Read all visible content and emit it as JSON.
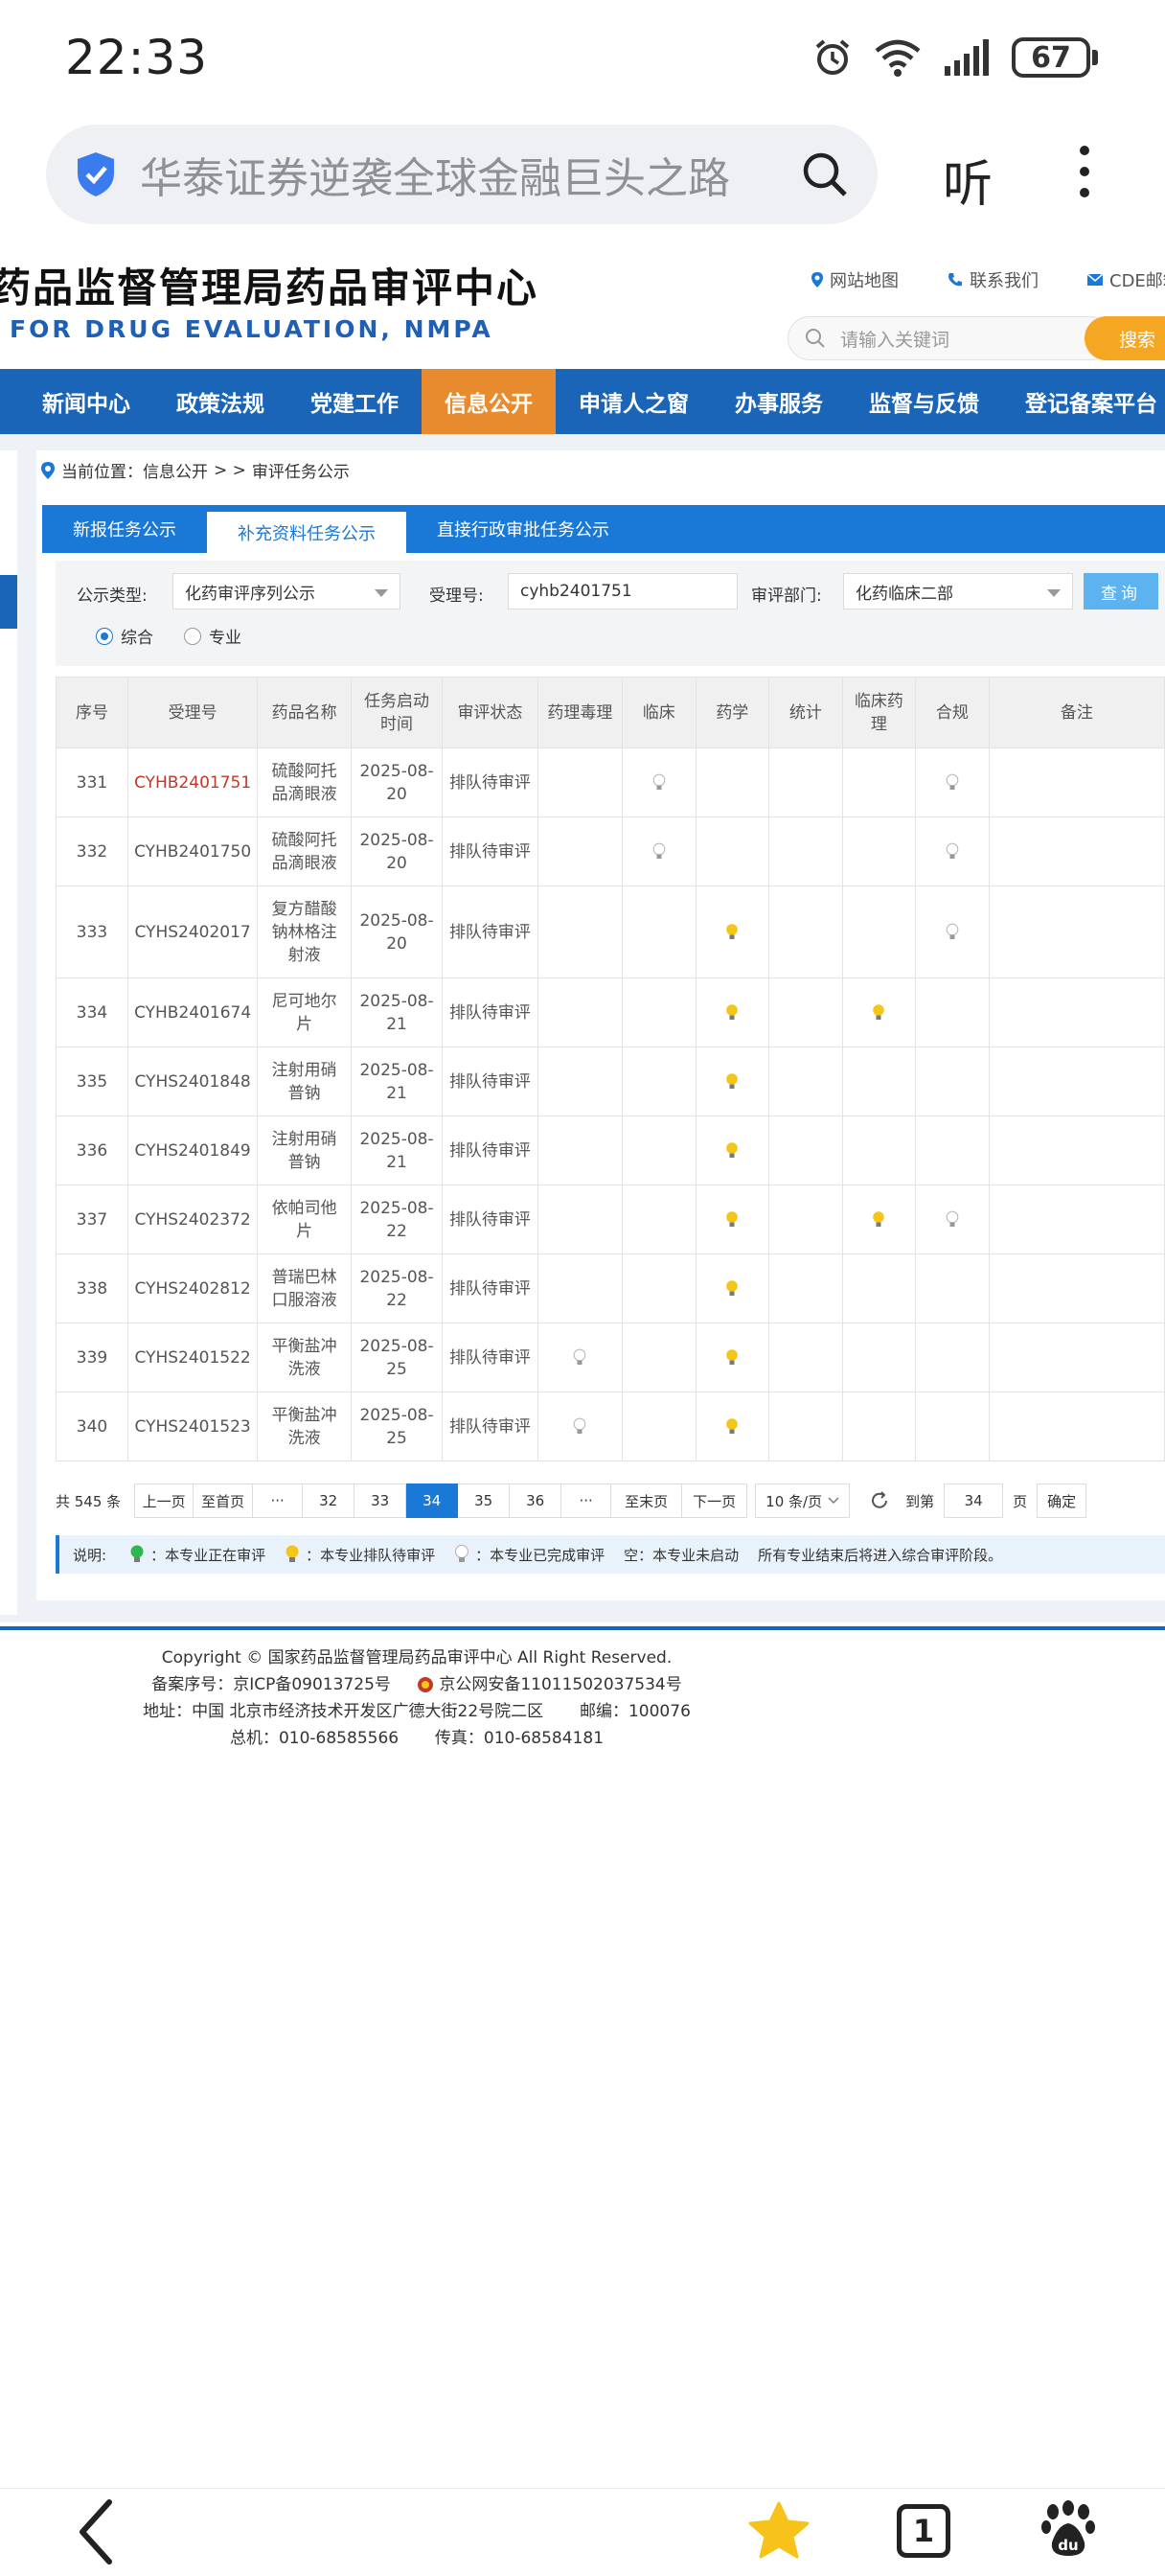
{
  "status": {
    "time": "22:33",
    "battery": "67"
  },
  "browser": {
    "search_text": "华泰证券逆袭全球金融巨头之路",
    "listen_label": "听",
    "tabs_count": "1"
  },
  "site": {
    "title": "药品监督管理局药品审评中心",
    "subtitle": "FOR DRUG EVALUATION, NMPA",
    "links": [
      "网站地图",
      "联系我们",
      "CDE邮箱"
    ],
    "search_placeholder": "请输入关键词",
    "search_button": "搜索"
  },
  "nav": {
    "items": [
      "新闻中心",
      "政策法规",
      "党建工作",
      "信息公开",
      "申请人之窗",
      "办事服务",
      "监督与反馈",
      "登记备案平台"
    ],
    "active": "信息公开"
  },
  "breadcrumb": {
    "prefix": "当前位置：信息公开",
    "sep": "> >",
    "current": "审评任务公示"
  },
  "tabs": {
    "items": [
      "新报任务公示",
      "补充资料任务公示",
      "直接行政审批任务公示"
    ],
    "active": "补充资料任务公示"
  },
  "filters": {
    "type_label": "公示类型:",
    "type_value": "化药审评序列公示",
    "accept_label": "受理号:",
    "accept_value": "cyhb2401751",
    "dept_label": "审评部门:",
    "dept_value": "化药临床二部",
    "query_button": "查询",
    "radio_all": "综合",
    "radio_pro": "专业"
  },
  "table": {
    "headers": [
      "序号",
      "受理号",
      "药品名称",
      "任务启动时间",
      "审评状态",
      "药理毒理",
      "临床",
      "药学",
      "统计",
      "临床药理",
      "合规",
      "备注"
    ],
    "rows": [
      {
        "no": "331",
        "accept": "CYHB2401751",
        "name": "硫酸阿托品滴眼液",
        "date": "2025-08-20",
        "status": "排队待审评",
        "marks": [
          "",
          "done",
          "",
          "",
          "",
          "done"
        ]
      },
      {
        "no": "332",
        "accept": "CYHB2401750",
        "name": "硫酸阿托品滴眼液",
        "date": "2025-08-20",
        "status": "排队待审评",
        "marks": [
          "",
          "done",
          "",
          "",
          "",
          "done"
        ]
      },
      {
        "no": "333",
        "accept": "CYHS2402017",
        "name": "复方醋酸钠林格注射液",
        "date": "2025-08-20",
        "status": "排队待审评",
        "marks": [
          "",
          "",
          "queue",
          "",
          "",
          "done"
        ]
      },
      {
        "no": "334",
        "accept": "CYHB2401674",
        "name": "尼可地尔片",
        "date": "2025-08-21",
        "status": "排队待审评",
        "marks": [
          "",
          "",
          "queue",
          "",
          "queue",
          ""
        ]
      },
      {
        "no": "335",
        "accept": "CYHS2401848",
        "name": "注射用硝普钠",
        "date": "2025-08-21",
        "status": "排队待审评",
        "marks": [
          "",
          "",
          "queue",
          "",
          "",
          ""
        ]
      },
      {
        "no": "336",
        "accept": "CYHS2401849",
        "name": "注射用硝普钠",
        "date": "2025-08-21",
        "status": "排队待审评",
        "marks": [
          "",
          "",
          "queue",
          "",
          "",
          ""
        ]
      },
      {
        "no": "337",
        "accept": "CYHS2402372",
        "name": "依帕司他片",
        "date": "2025-08-22",
        "status": "排队待审评",
        "marks": [
          "",
          "",
          "queue",
          "",
          "queue",
          "done"
        ]
      },
      {
        "no": "338",
        "accept": "CYHS2402812",
        "name": "普瑞巴林口服溶液",
        "date": "2025-08-22",
        "status": "排队待审评",
        "marks": [
          "",
          "",
          "queue",
          "",
          "",
          ""
        ]
      },
      {
        "no": "339",
        "accept": "CYHS2401522",
        "name": "平衡盐冲洗液",
        "date": "2025-08-25",
        "status": "排队待审评",
        "marks": [
          "done",
          "",
          "queue",
          "",
          "",
          ""
        ]
      },
      {
        "no": "340",
        "accept": "CYHS2401523",
        "name": "平衡盐冲洗液",
        "date": "2025-08-25",
        "status": "排队待审评",
        "marks": [
          "done",
          "",
          "queue",
          "",
          "",
          ""
        ]
      }
    ]
  },
  "pager": {
    "total": "共 545 条",
    "prev": "上一页",
    "first": "至首页",
    "ellipsis": "···",
    "pages": [
      "32",
      "33",
      "34",
      "35",
      "36"
    ],
    "current": "34",
    "last": "至末页",
    "next": "下一页",
    "page_size": "10 条/页",
    "goto_prefix": "到第",
    "goto_value": "34",
    "goto_suffix": "页",
    "confirm": "确定"
  },
  "legend": {
    "label": "说明:",
    "in_review": "：本专业正在审评",
    "queued": "：本专业排队待审评",
    "done": "：本专业已完成审评",
    "empty": "空：本专业未启动",
    "note": "所有专业结束后将进入综合审评阶段。"
  },
  "footer": {
    "copyright": "Copyright © 国家药品监督管理局药品审评中心   All Right Reserved.",
    "icp": "备案序号：京ICP备09013725号",
    "police": "京公网安备11011502037534号",
    "address": "地址：中国 北京市经济技术开发区广德大街22号院二区",
    "postcode": "邮编：100076",
    "phone": "总机：010-68585566",
    "fax": "传真：010-68584181"
  },
  "colors": {
    "nav_blue": "#1a65b8",
    "active_orange": "#e88a2e",
    "tab_blue": "#1a78d6",
    "bulb_green": "#2db84d",
    "bulb_yellow": "#f5c518",
    "bulb_grey": "#cfcfcf",
    "highlight_red": "#c0392b"
  }
}
